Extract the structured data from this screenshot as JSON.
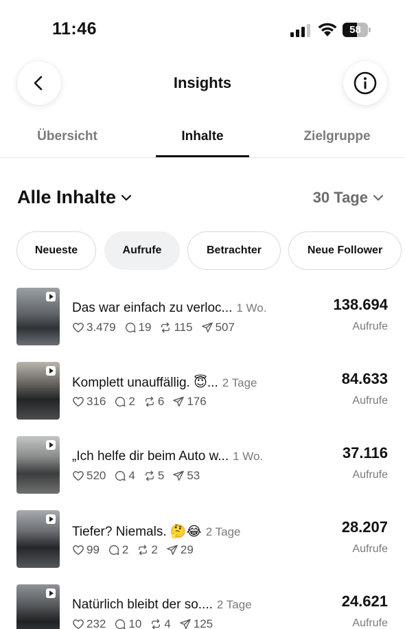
{
  "status_bar": {
    "time": "11:46",
    "battery": "58",
    "battery_level": 0.58
  },
  "header": {
    "title": "Insights"
  },
  "tabs": [
    {
      "label": "Übersicht"
    },
    {
      "label": "Inhalte"
    },
    {
      "label": "Zielgruppe"
    }
  ],
  "content": {
    "title": "Alle Inhalte",
    "period": "30 Tage"
  },
  "filters": [
    {
      "label": "Neueste"
    },
    {
      "label": "Aufrufe"
    },
    {
      "label": "Betrachter"
    },
    {
      "label": "Neue Follower"
    }
  ],
  "items": [
    {
      "title": "Das war einfach zu verloc...",
      "age": "1 Wo.",
      "likes": "3.479",
      "comments": "19",
      "reposts": "115",
      "shares": "507",
      "views": "138.694",
      "views_label": "Aufrufe"
    },
    {
      "title": "Komplett unauffällig. 😇...",
      "age": "2 Tage",
      "likes": "316",
      "comments": "2",
      "reposts": "6",
      "shares": "176",
      "views": "84.633",
      "views_label": "Aufrufe"
    },
    {
      "title": "„Ich helfe dir beim Auto w...",
      "age": "1 Wo.",
      "likes": "520",
      "comments": "4",
      "reposts": "5",
      "shares": "53",
      "views": "37.116",
      "views_label": "Aufrufe"
    },
    {
      "title": "Tiefer? Niemals. 🤔😂",
      "age": "2 Tage",
      "likes": "99",
      "comments": "2",
      "reposts": "2",
      "shares": "29",
      "views": "28.207",
      "views_label": "Aufrufe"
    },
    {
      "title": "Natürlich bleibt der so....",
      "age": "2 Tage",
      "likes": "232",
      "comments": "10",
      "reposts": "4",
      "shares": "125",
      "views": "24.621",
      "views_label": "Aufrufe"
    }
  ]
}
